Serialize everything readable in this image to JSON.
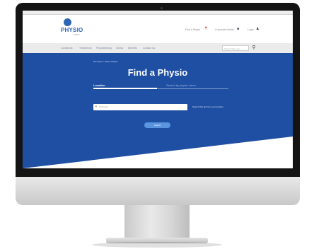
{
  "header": {
    "logo": {
      "main": "PHYSIO",
      "sub": "FIRST"
    },
    "links": [
      {
        "label": "Find a Physio",
        "icon": "location-pin-icon"
      },
      {
        "label": "Corporate Health",
        "icon": "briefcase-icon"
      },
      {
        "label": "Login",
        "icon": "user-icon"
      }
    ]
  },
  "nav": {
    "items": [
      "Conditions",
      "Treatments",
      "Physiotherapy",
      "Clinics",
      "Benefits",
      "Contact Us"
    ],
    "search": {
      "placeholder": "Search Site Here",
      "icon": "search-icon"
    }
  },
  "hero": {
    "breadcrumb": "PF Home > Find a Physio",
    "title": "Find a Physio",
    "tabs": [
      {
        "label": "Location",
        "active": true
      },
      {
        "label": "Search by physio name",
        "active": false
      }
    ],
    "location_input": {
      "placeholder": "Postcode",
      "icon": "location-pin-icon"
    },
    "radius_select": "Search this far from your location",
    "search_button": "Search"
  },
  "colors": {
    "brand_blue": "#1f4fa3",
    "button_blue": "#5b95e0"
  }
}
